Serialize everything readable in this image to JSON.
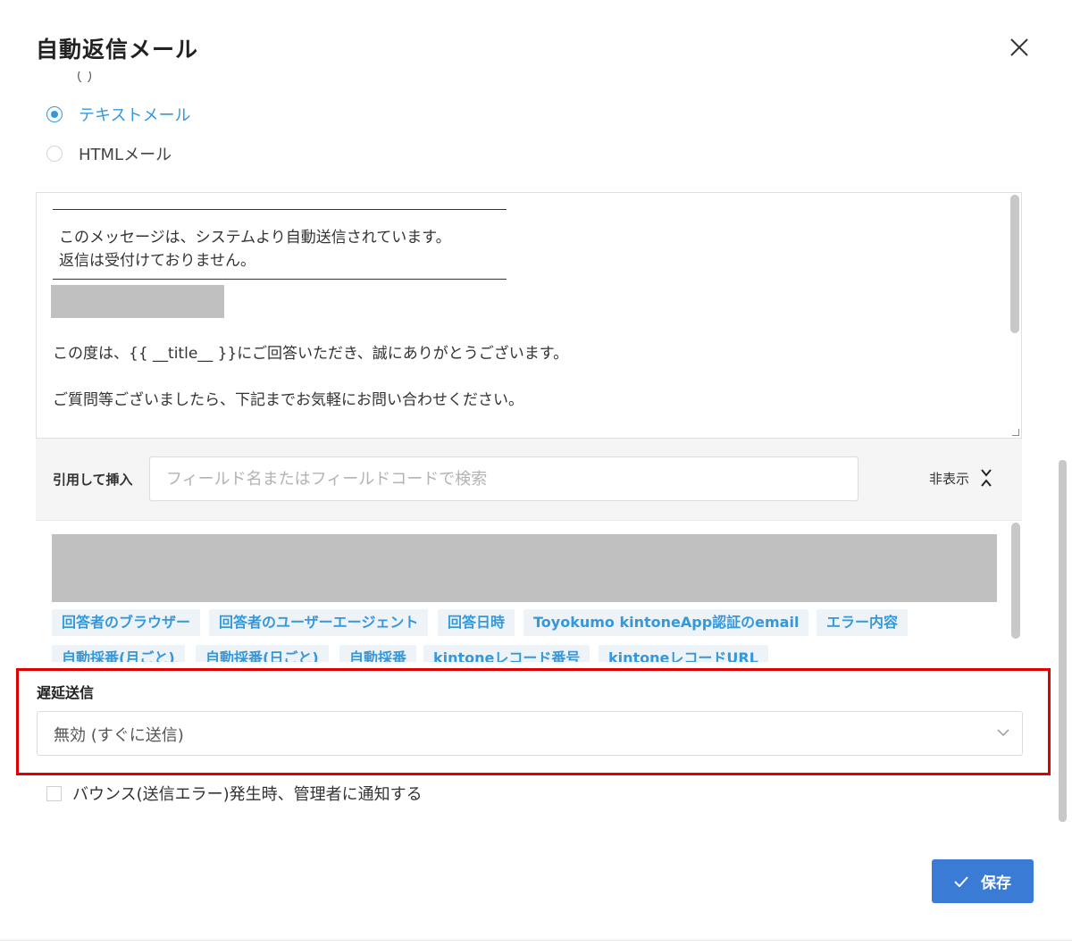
{
  "dialog": {
    "title": "自動返信メール"
  },
  "format": {
    "clipped_heading": "（ ）",
    "options": [
      {
        "label": "テキストメール",
        "checked": true
      },
      {
        "label": "HTMLメール",
        "checked": false
      }
    ]
  },
  "editor": {
    "lines": [
      "このメッセージは、システムより自動送信されています。",
      "返信は受付けておりません。",
      "この度は、{{ __title__ }}にご回答いただき、誠にありがとうございます。",
      "ご質問等ございましたら、下記までお気軽にお問い合わせください。"
    ]
  },
  "insert": {
    "label": "引用して挿入",
    "search_placeholder": "フィールド名またはフィールドコードで検索",
    "hide_label": "非表示",
    "tags_row1": [
      "回答者のブラウザー",
      "回答者のユーザーエージェント",
      "回答日時",
      "Toyokumo kintoneApp認証のemail",
      "エラー内容"
    ],
    "tags_row2": [
      "自動採番(月ごと)",
      "自動採番(日ごと)",
      "自動採番",
      "kintoneレコード番号",
      "kintoneレコードURL"
    ]
  },
  "delay": {
    "label": "遅延送信",
    "selected": "無効 (すぐに送信)"
  },
  "bounce": {
    "label": "バウンス(送信エラー)発生時、管理者に通知する",
    "checked": false
  },
  "actions": {
    "save_label": "保存"
  },
  "colors": {
    "accent": "#3498db",
    "button": "#3a7bd5",
    "highlight": "#e00000"
  }
}
